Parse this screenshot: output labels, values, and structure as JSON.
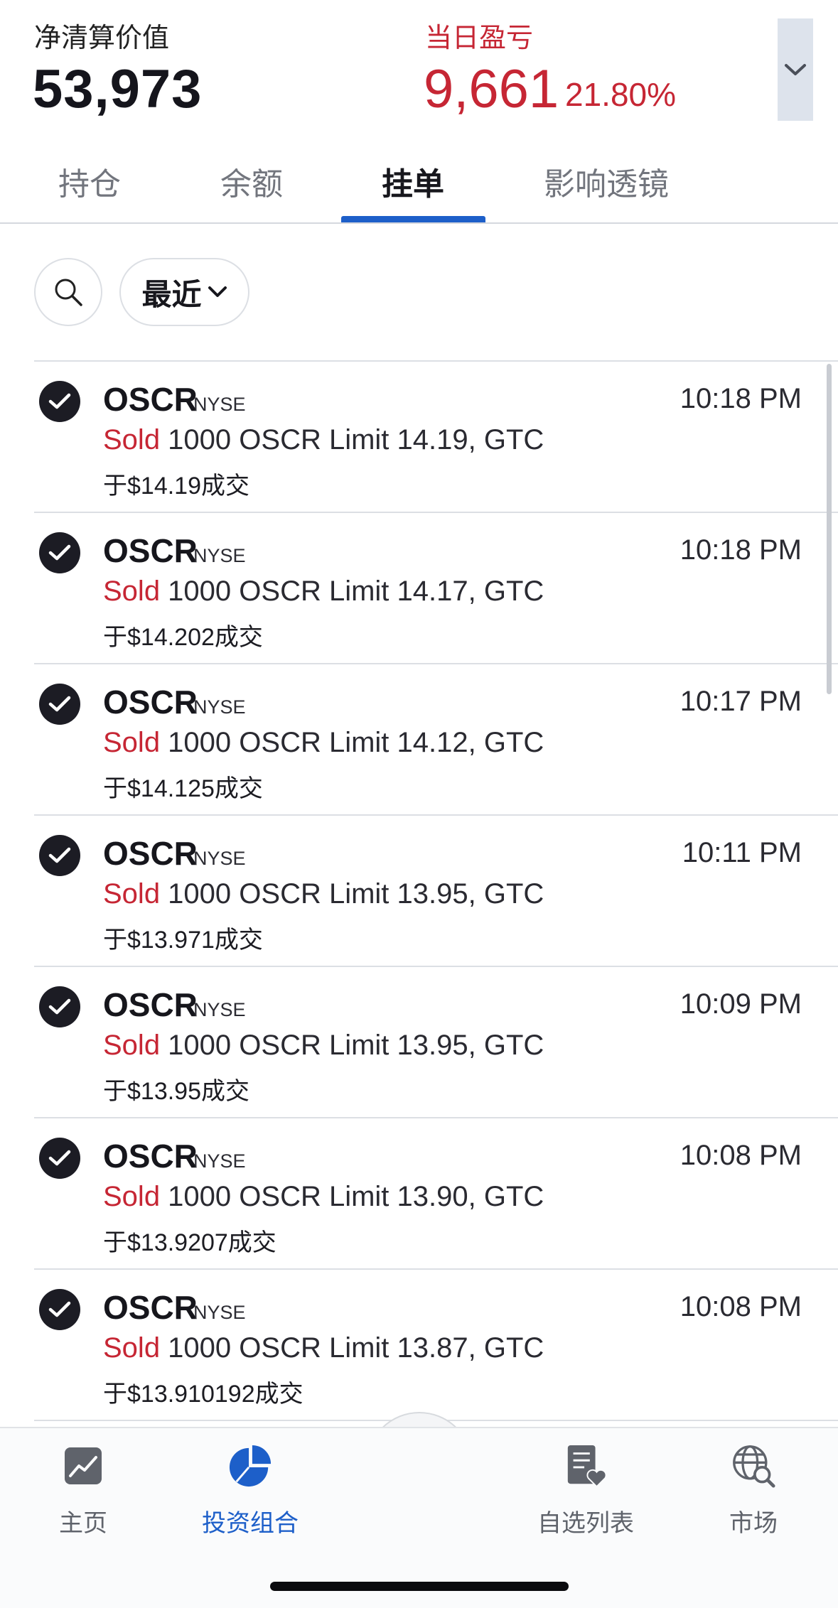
{
  "summary": {
    "net_value_label": "净清算价值",
    "net_value": "53,973",
    "day_pl_label": "当日盈亏",
    "day_pl_value": "9,661",
    "day_pl_pct": "21.80%",
    "expand_icon": "chevron-down-icon"
  },
  "tabs": [
    {
      "label": "持仓"
    },
    {
      "label": "余额"
    },
    {
      "label": "挂单",
      "active": true
    },
    {
      "label": "影响透镜"
    }
  ],
  "filters": {
    "search_icon": "search-icon",
    "recent_label": "最近"
  },
  "orders": [
    {
      "symbol": "OSCR",
      "exchange": "NYSE",
      "time": "10:18 PM",
      "side": "Sold",
      "detail": " 1000 OSCR Limit 14.19, GTC",
      "fill": "于$14.19成交",
      "status_icon": "check-circle-icon"
    },
    {
      "symbol": "OSCR",
      "exchange": "NYSE",
      "time": "10:18 PM",
      "side": "Sold",
      "detail": " 1000 OSCR Limit 14.17, GTC",
      "fill": "于$14.202成交",
      "status_icon": "check-circle-icon"
    },
    {
      "symbol": "OSCR",
      "exchange": "NYSE",
      "time": "10:17 PM",
      "side": "Sold",
      "detail": " 1000 OSCR Limit 14.12, GTC",
      "fill": "于$14.125成交",
      "status_icon": "check-circle-icon"
    },
    {
      "symbol": "OSCR",
      "exchange": "NYSE",
      "time": "10:11 PM",
      "side": "Sold",
      "detail": " 1000 OSCR Limit 13.95, GTC",
      "fill": "于$13.971成交",
      "status_icon": "check-circle-icon"
    },
    {
      "symbol": "OSCR",
      "exchange": "NYSE",
      "time": "10:09 PM",
      "side": "Sold",
      "detail": " 1000 OSCR Limit 13.95, GTC",
      "fill": "于$13.95成交",
      "status_icon": "check-circle-icon"
    },
    {
      "symbol": "OSCR",
      "exchange": "NYSE",
      "time": "10:08 PM",
      "side": "Sold",
      "detail": " 1000 OSCR Limit 13.90, GTC",
      "fill": "于$13.9207成交",
      "status_icon": "check-circle-icon"
    },
    {
      "symbol": "OSCR",
      "exchange": "NYSE",
      "time": "10:08 PM",
      "side": "Sold",
      "detail": " 1000 OSCR Limit 13.87, GTC",
      "fill": "于$13.910192成交",
      "status_icon": "check-circle-icon"
    }
  ],
  "bottom_nav": [
    {
      "label": "主页",
      "icon": "chart-icon"
    },
    {
      "label": "投资组合",
      "icon": "pie-chart-icon",
      "active": true
    },
    {
      "label": "自选列表",
      "icon": "watchlist-icon"
    },
    {
      "label": "市场",
      "icon": "globe-search-icon"
    }
  ],
  "fab_icon": "expand-arrows-icon",
  "colors": {
    "loss_red": "#c62634",
    "accent_blue": "#1d5fc9"
  }
}
